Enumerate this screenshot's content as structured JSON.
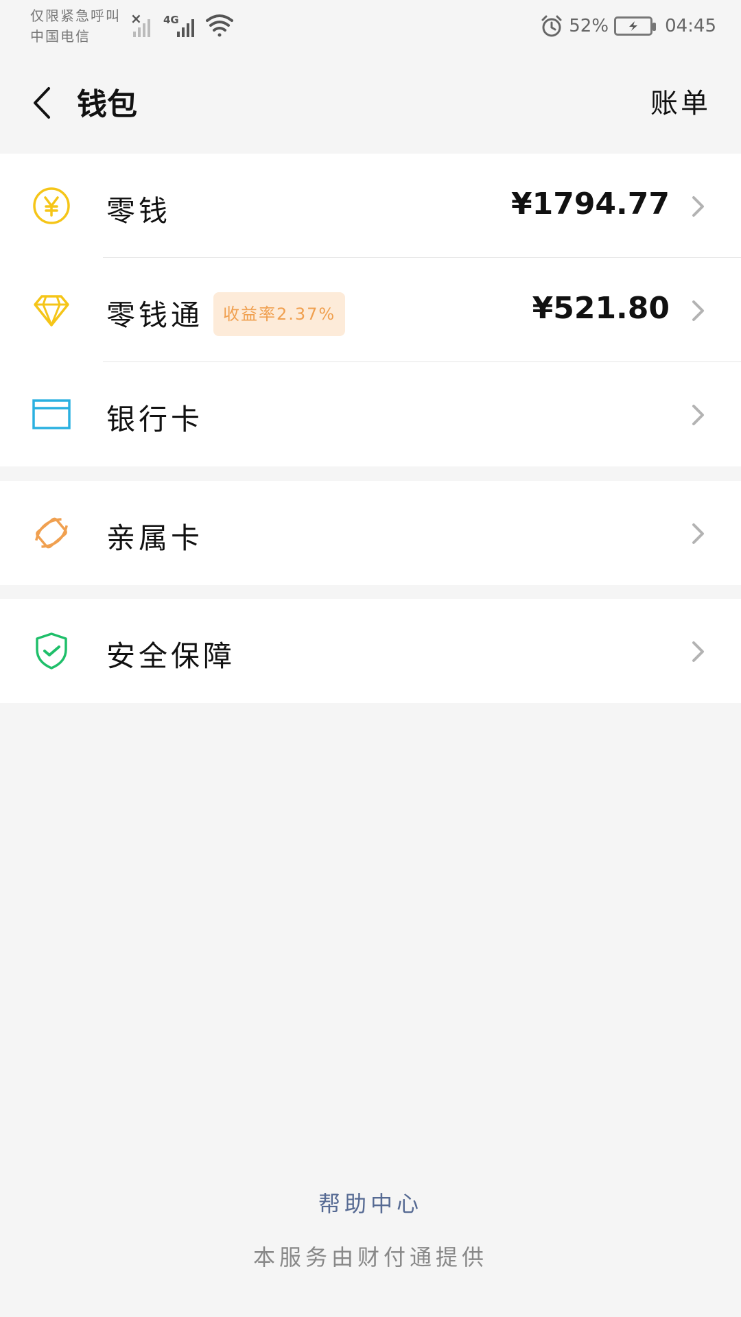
{
  "status_bar": {
    "carrier_line1": "仅限紧急呼叫",
    "carrier_line2": "中国电信",
    "network_type": "4G",
    "battery": "52%",
    "time": "04:45",
    "icons": [
      "signal-off-icon",
      "signal-icon",
      "wifi-icon",
      "alarm-icon",
      "battery-charging-icon"
    ]
  },
  "nav": {
    "title": "钱包",
    "right_action": "账单"
  },
  "wallet_items": [
    {
      "label": "零钱",
      "amount": "¥1794.77",
      "icon": "yuan-coin-icon",
      "color": "#f5c518"
    },
    {
      "label": "零钱通",
      "badge": "收益率2.37%",
      "amount": "¥521.80",
      "icon": "diamond-icon",
      "color": "#f5c518"
    },
    {
      "label": "银行卡",
      "icon": "bank-card-icon",
      "color": "#2ab0e0"
    }
  ],
  "family_card": {
    "label": "亲属卡",
    "icon": "family-card-icon",
    "color": "#f0a050"
  },
  "security": {
    "label": "安全保障",
    "icon": "shield-check-icon",
    "color": "#1fbf6a"
  },
  "footer": {
    "help": "帮助中心",
    "provider": "本服务由财付通提供"
  }
}
